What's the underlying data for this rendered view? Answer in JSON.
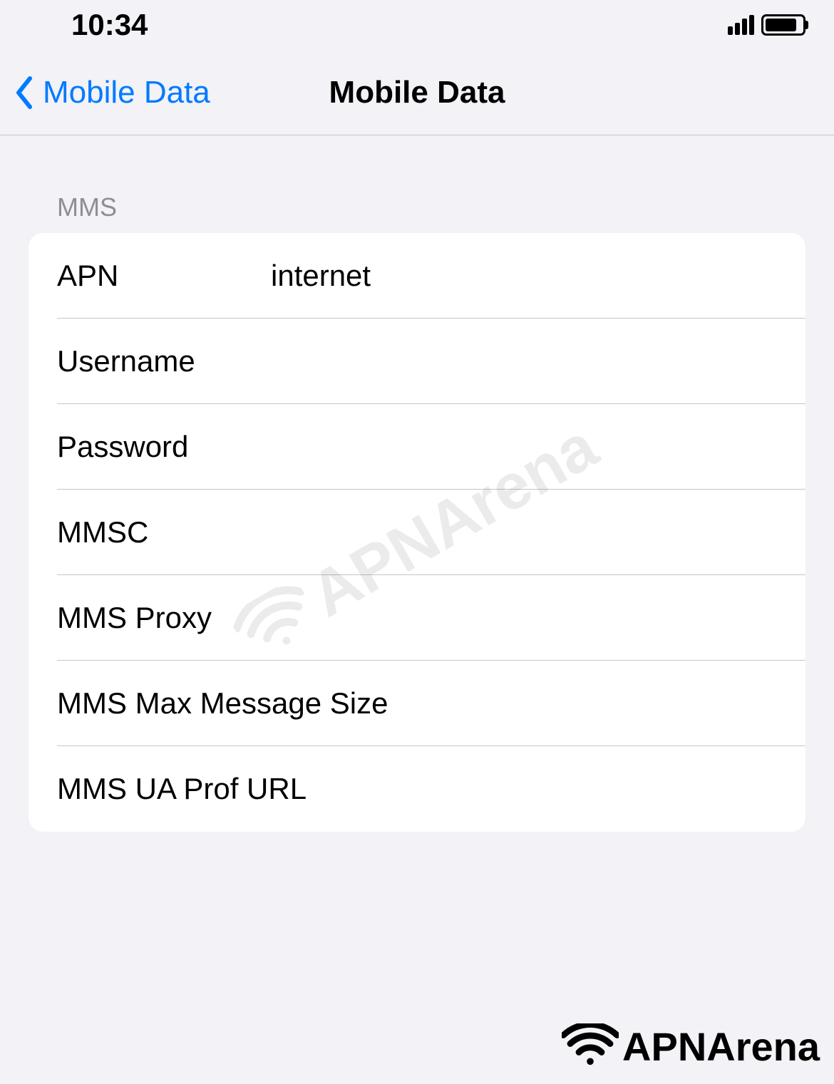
{
  "status_bar": {
    "time": "10:34"
  },
  "nav": {
    "back_label": "Mobile Data",
    "title": "Mobile Data"
  },
  "section": {
    "header": "MMS",
    "rows": [
      {
        "label": "APN",
        "value": "internet"
      },
      {
        "label": "Username",
        "value": ""
      },
      {
        "label": "Password",
        "value": ""
      },
      {
        "label": "MMSC",
        "value": ""
      },
      {
        "label": "MMS Proxy",
        "value": ""
      },
      {
        "label": "MMS Max Message Size",
        "value": ""
      },
      {
        "label": "MMS UA Prof URL",
        "value": ""
      }
    ]
  },
  "watermark": {
    "text": "APNArena"
  },
  "branding": {
    "text": "APNArena"
  }
}
